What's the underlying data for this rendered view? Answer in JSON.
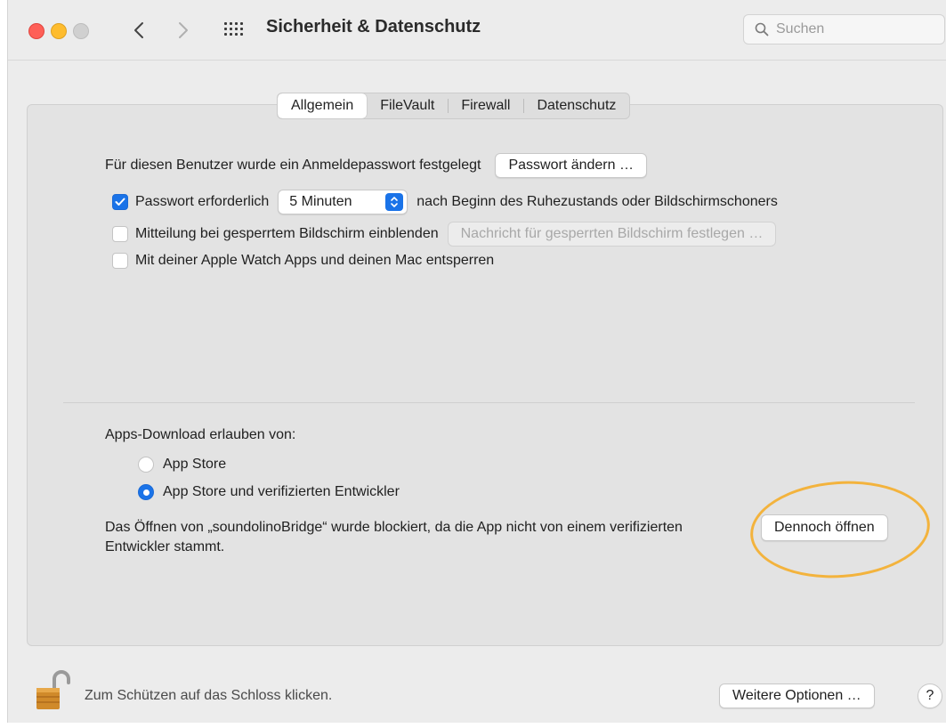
{
  "window": {
    "title": "Sicherheit & Datenschutz",
    "search_placeholder": "Suchen"
  },
  "tabs": [
    {
      "label": "Allgemein",
      "active": true
    },
    {
      "label": "FileVault",
      "active": false
    },
    {
      "label": "Firewall",
      "active": false
    },
    {
      "label": "Datenschutz",
      "active": false
    }
  ],
  "general": {
    "password_set_text": "Für diesen Benutzer wurde ein Anmeldepasswort festgelegt",
    "change_password_button": "Passwort ändern …",
    "require_password": {
      "checked": true,
      "label_before": "Passwort erforderlich",
      "popup_value": "5 Minuten",
      "label_after": "nach Beginn des Ruhezustands oder Bildschirmschoners"
    },
    "show_message": {
      "checked": false,
      "label": "Mitteilung bei gesperrtem Bildschirm einblenden",
      "button": "Nachricht für gesperrten Bildschirm festlegen …"
    },
    "apple_watch": {
      "checked": false,
      "label": "Mit deiner Apple Watch Apps und deinen Mac entsperren"
    }
  },
  "downloads": {
    "heading": "Apps-Download erlauben von:",
    "options": [
      {
        "label": "App Store",
        "selected": false
      },
      {
        "label": "App Store und verifizierten Entwickler",
        "selected": true
      }
    ],
    "blocked_message": "Das Öffnen von „soundolinoBridge“ wurde blockiert, da die App nicht von einem verifizierten Entwickler stammt.",
    "open_anyway_button": "Dennoch öffnen"
  },
  "footer": {
    "lock_text": "Zum Schützen auf das Schloss klicken.",
    "more_options_button": "Weitere Optionen …",
    "help_label": "?"
  },
  "colors": {
    "accent": "#1a73e8",
    "highlight_circle": "#f3b33d"
  }
}
